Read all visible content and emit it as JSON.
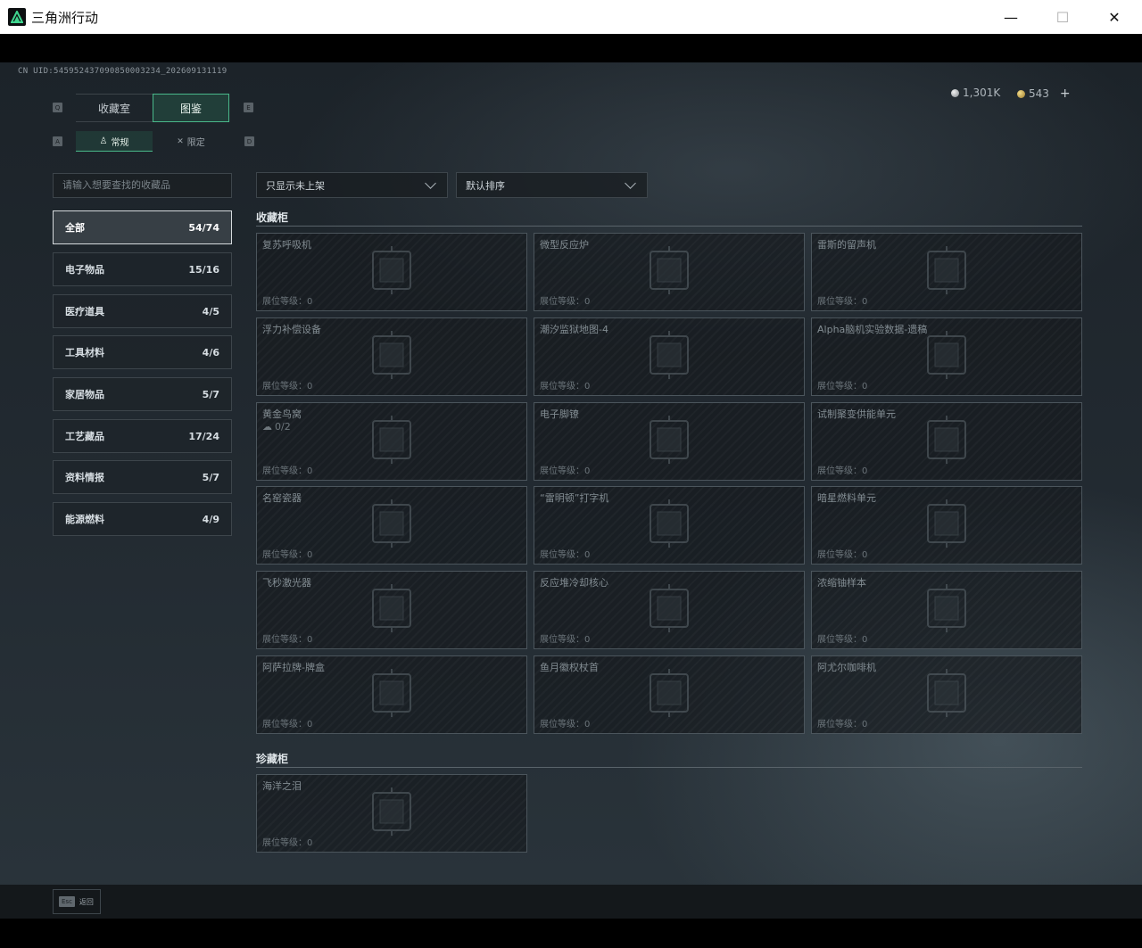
{
  "window": {
    "title": "三角洲行动",
    "minimize": "—",
    "maximize": "☐",
    "close": "✕"
  },
  "uid": "CN UID:545952437090850003234_202609131119",
  "currency": {
    "silver": "1,301K",
    "gold": "543",
    "plus": "+"
  },
  "tabs": {
    "primary": [
      {
        "label": "收藏室",
        "key": "Q"
      },
      {
        "label": "图鉴",
        "key": "E"
      }
    ],
    "primary_active": "图鉴",
    "secondary": [
      {
        "label": "常规",
        "key": "A"
      },
      {
        "label": "限定",
        "key": "D"
      }
    ],
    "secondary_active": "常规"
  },
  "search": {
    "placeholder": "请输入想要查找的收藏品"
  },
  "categories": [
    {
      "label": "全部",
      "count": "54/74"
    },
    {
      "label": "电子物品",
      "count": "15/16"
    },
    {
      "label": "医疗道具",
      "count": "4/5"
    },
    {
      "label": "工具材料",
      "count": "4/6"
    },
    {
      "label": "家居物品",
      "count": "5/7"
    },
    {
      "label": "工艺藏品",
      "count": "17/24"
    },
    {
      "label": "资料情报",
      "count": "5/7"
    },
    {
      "label": "能源燃料",
      "count": "4/9"
    }
  ],
  "filters": {
    "filter": "只显示未上架",
    "sort": "默认排序"
  },
  "sections": {
    "cabinet": {
      "title": "收藏柜",
      "items": [
        {
          "name": "复苏呼吸机",
          "level": "展位等级：0"
        },
        {
          "name": "微型反应炉",
          "level": "展位等级：0"
        },
        {
          "name": "雷斯的留声机",
          "level": "展位等级：0"
        },
        {
          "name": "浮力补偿设备",
          "level": "展位等级：0"
        },
        {
          "name": "潮汐监狱地图-4",
          "level": "展位等级：0"
        },
        {
          "name": "Alpha脑机实验数据-遗稿",
          "level": "展位等级：0"
        },
        {
          "name": "黄金鸟窝",
          "sub": "0/2",
          "level": "展位等级：0"
        },
        {
          "name": "电子脚镣",
          "level": "展位等级：0"
        },
        {
          "name": "试制聚变供能单元",
          "level": "展位等级：0"
        },
        {
          "name": "名窑瓷器",
          "level": "展位等级：0"
        },
        {
          "name": "“雷明顿”打字机",
          "level": "展位等级：0"
        },
        {
          "name": "暗星燃料单元",
          "level": "展位等级：0"
        },
        {
          "name": "飞秒激光器",
          "level": "展位等级：0"
        },
        {
          "name": "反应堆冷却核心",
          "level": "展位等级：0"
        },
        {
          "name": "浓缩铀样本",
          "level": "展位等级：0"
        },
        {
          "name": "阿萨拉牌-牌盒",
          "level": "展位等级：0"
        },
        {
          "name": "鱼月徽权杖首",
          "level": "展位等级：0"
        },
        {
          "name": "阿尤尔咖啡机",
          "level": "展位等级：0"
        }
      ]
    },
    "treasure": {
      "title": "珍藏柜",
      "items": [
        {
          "name": "海洋之泪",
          "level": "展位等级：0"
        }
      ]
    }
  },
  "footer": {
    "key": "Esc",
    "label": "返回"
  },
  "colors": {
    "accent": "#49b88a",
    "card_border": "#4b555c",
    "background": "#222a31"
  }
}
